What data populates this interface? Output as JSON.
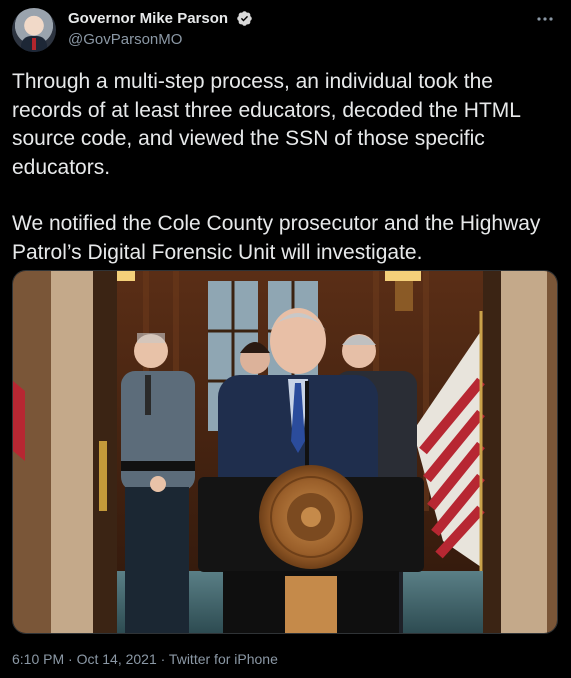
{
  "author": {
    "display_name": "Governor Mike Parson",
    "handle": "@GovParsonMO",
    "verified": true,
    "avatar_icon": "user-avatar"
  },
  "tweet": {
    "paragraphs": [
      "Through a multi-step process, an individual took the records of at least three educators, decoded the HTML source code, and viewed the SSN of those specific educators.",
      "We notified the Cole County prosecutor and the Highway Patrol’s Digital Forensic Unit will investigate."
    ]
  },
  "media": {
    "type": "photo",
    "alt_description": "press-conference-photo",
    "seal_text": "THE GREAT SEAL OF THE STATE OF MISSOURI"
  },
  "meta": {
    "timestamp": "6:10 PM · Oct 14, 2021 · Twitter for iPhone"
  },
  "colors": {
    "background": "#000000",
    "text_primary": "#e7e9ea",
    "text_secondary": "#8b98a5",
    "verified": "#d9d9d9"
  },
  "icons": {
    "more": "more-horizontal-icon",
    "verified": "verified-badge-icon"
  }
}
